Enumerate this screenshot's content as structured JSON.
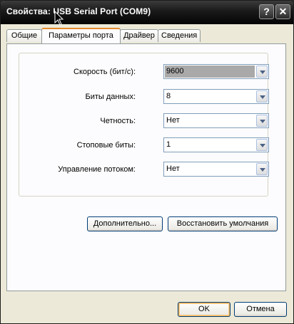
{
  "window": {
    "title": "Свойства: USB Serial Port (COM9)",
    "help_glyph": "?",
    "close_glyph": "✕"
  },
  "tabs": [
    {
      "label": "Общие",
      "active": false
    },
    {
      "label": "Параметры порта",
      "active": true
    },
    {
      "label": "Драйвер",
      "active": false
    },
    {
      "label": "Сведения",
      "active": false
    }
  ],
  "settings": {
    "bits_per_second": {
      "label": "Скорость (бит/с):",
      "value": "9600"
    },
    "data_bits": {
      "label": "Биты данных:",
      "value": "8"
    },
    "parity": {
      "label": "Четность:",
      "value": "Нет"
    },
    "stop_bits": {
      "label": "Стоповые биты:",
      "value": "1"
    },
    "flow_control": {
      "label": "Управление потоком:",
      "value": "Нет"
    }
  },
  "buttons": {
    "advanced": "Дополнительно...",
    "restore_defaults": "Восстановить умолчания",
    "ok": "OK",
    "cancel": "Отмена"
  }
}
